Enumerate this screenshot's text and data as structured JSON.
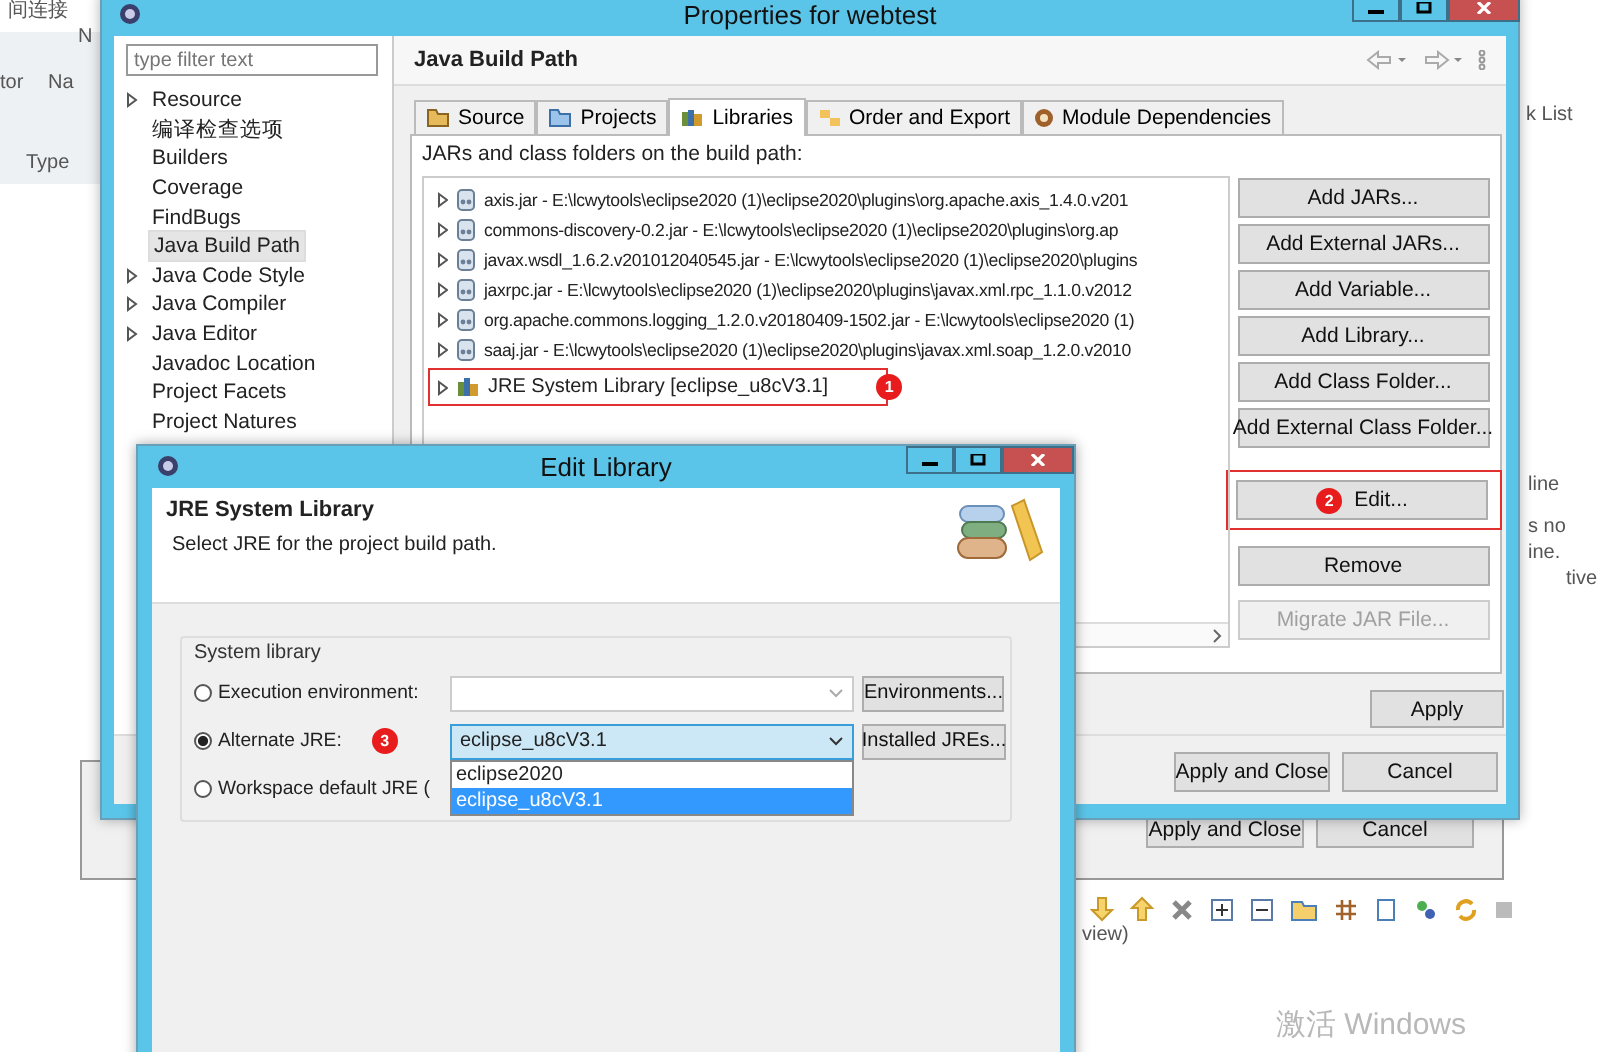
{
  "background": {
    "title_fragment": "间连接",
    "fragments": [
      {
        "text": "N"
      },
      {
        "text": "tor"
      },
      {
        "text": "Na"
      },
      {
        "text": "Type"
      },
      {
        "text": "k List"
      },
      {
        "text": "line"
      },
      {
        "text": "s no"
      },
      {
        "text": "ine."
      },
      {
        "text": "tive"
      },
      {
        "text": "view)"
      }
    ],
    "buttons": [
      "Apply and Close",
      "Cancel"
    ],
    "activation_notice": "激活 Windows"
  },
  "properties_window": {
    "title": "Properties for webtest",
    "filter": {
      "placeholder": "type filter text"
    },
    "tree": [
      {
        "label": "Resource",
        "kind": "folder",
        "selected": false
      },
      {
        "label": "编译检查选项",
        "kind": "leaf",
        "selected": false
      },
      {
        "label": "Builders",
        "kind": "leaf",
        "selected": false
      },
      {
        "label": "Coverage",
        "kind": "leaf",
        "selected": false
      },
      {
        "label": "FindBugs",
        "kind": "leaf",
        "selected": false
      },
      {
        "label": "Java Build Path",
        "kind": "leaf",
        "selected": true
      },
      {
        "label": "Java Code Style",
        "kind": "folder",
        "selected": false
      },
      {
        "label": "Java Compiler",
        "kind": "folder",
        "selected": false
      },
      {
        "label": "Java Editor",
        "kind": "folder",
        "selected": false
      },
      {
        "label": "Javadoc Location",
        "kind": "leaf",
        "selected": false
      },
      {
        "label": "Project Facets",
        "kind": "leaf",
        "selected": false
      },
      {
        "label": "Project Natures",
        "kind": "leaf",
        "selected": false
      }
    ],
    "page_title": "Java Build Path",
    "tabs": [
      {
        "label": "Source",
        "kind": "source",
        "selected": false
      },
      {
        "label": "Projects",
        "kind": "projects",
        "selected": false
      },
      {
        "label": "Libraries",
        "kind": "libraries",
        "selected": true
      },
      {
        "label": "Order and Export",
        "kind": "order",
        "selected": false
      },
      {
        "label": "Module Dependencies",
        "kind": "module",
        "selected": false
      }
    ],
    "list_label": "JARs and class folders on the build path:",
    "libraries": [
      {
        "label": "axis.jar - E:\\lcwytools\\eclipse2020 (1)\\eclipse2020\\plugins\\org.apache.axis_1.4.0.v201",
        "kind": "jar",
        "highlighted": false
      },
      {
        "label": "commons-discovery-0.2.jar - E:\\lcwytools\\eclipse2020 (1)\\eclipse2020\\plugins\\org.ap",
        "kind": "jar",
        "highlighted": false
      },
      {
        "label": "javax.wsdl_1.6.2.v201012040545.jar - E:\\lcwytools\\eclipse2020 (1)\\eclipse2020\\plugins",
        "kind": "jar",
        "highlighted": false
      },
      {
        "label": "jaxrpc.jar - E:\\lcwytools\\eclipse2020 (1)\\eclipse2020\\plugins\\javax.xml.rpc_1.1.0.v2012",
        "kind": "jar",
        "highlighted": false
      },
      {
        "label": "org.apache.commons.logging_1.2.0.v20180409-1502.jar - E:\\lcwytools\\eclipse2020 (1)",
        "kind": "jar",
        "highlighted": false
      },
      {
        "label": "saaj.jar - E:\\lcwytools\\eclipse2020 (1)\\eclipse2020\\plugins\\javax.xml.soap_1.2.0.v2010",
        "kind": "jar",
        "highlighted": false
      },
      {
        "label": "JRE System Library [eclipse_u8cV3.1]",
        "kind": "jre",
        "highlighted": true,
        "badge": "1"
      }
    ],
    "button_groups": [
      [
        {
          "label": "Add JARs...",
          "disabled": false,
          "highlighted": false
        },
        {
          "label": "Add External JARs...",
          "disabled": false,
          "highlighted": false
        },
        {
          "label": "Add Variable...",
          "disabled": false,
          "highlighted": false
        },
        {
          "label": "Add Library...",
          "disabled": false,
          "highlighted": false
        },
        {
          "label": "Add Class Folder...",
          "disabled": false,
          "highlighted": false
        },
        {
          "label": "Add External Class Folder...",
          "disabled": false,
          "highlighted": false
        }
      ],
      [
        {
          "label": "Edit...",
          "disabled": false,
          "highlighted": true,
          "badge": "2"
        },
        {
          "label": "Remove",
          "disabled": false,
          "highlighted": false
        }
      ],
      [
        {
          "label": "Migrate JAR File...",
          "disabled": true,
          "highlighted": false
        }
      ]
    ],
    "apply": "Apply",
    "footer_buttons": [
      "Apply and Close",
      "Cancel"
    ]
  },
  "edit_library": {
    "title": "Edit Library",
    "heading": "JRE System Library",
    "description": "Select JRE for the project build path.",
    "group_label": "System library",
    "options": [
      {
        "label": "Execution environment:",
        "selected": false,
        "kind": "environment",
        "button": "Environments..."
      },
      {
        "label": "Alternate JRE:",
        "selected": true,
        "kind": "alternate",
        "combo_value": "eclipse_u8cV3.1",
        "button": "Installed JREs...",
        "badge": "3"
      },
      {
        "label": "Workspace default JRE (",
        "selected": false,
        "kind": "workspace"
      }
    ],
    "dropdown": [
      {
        "label": "eclipse2020",
        "selected": false
      },
      {
        "label": "eclipse_u8cV3.1",
        "selected": true
      }
    ]
  }
}
